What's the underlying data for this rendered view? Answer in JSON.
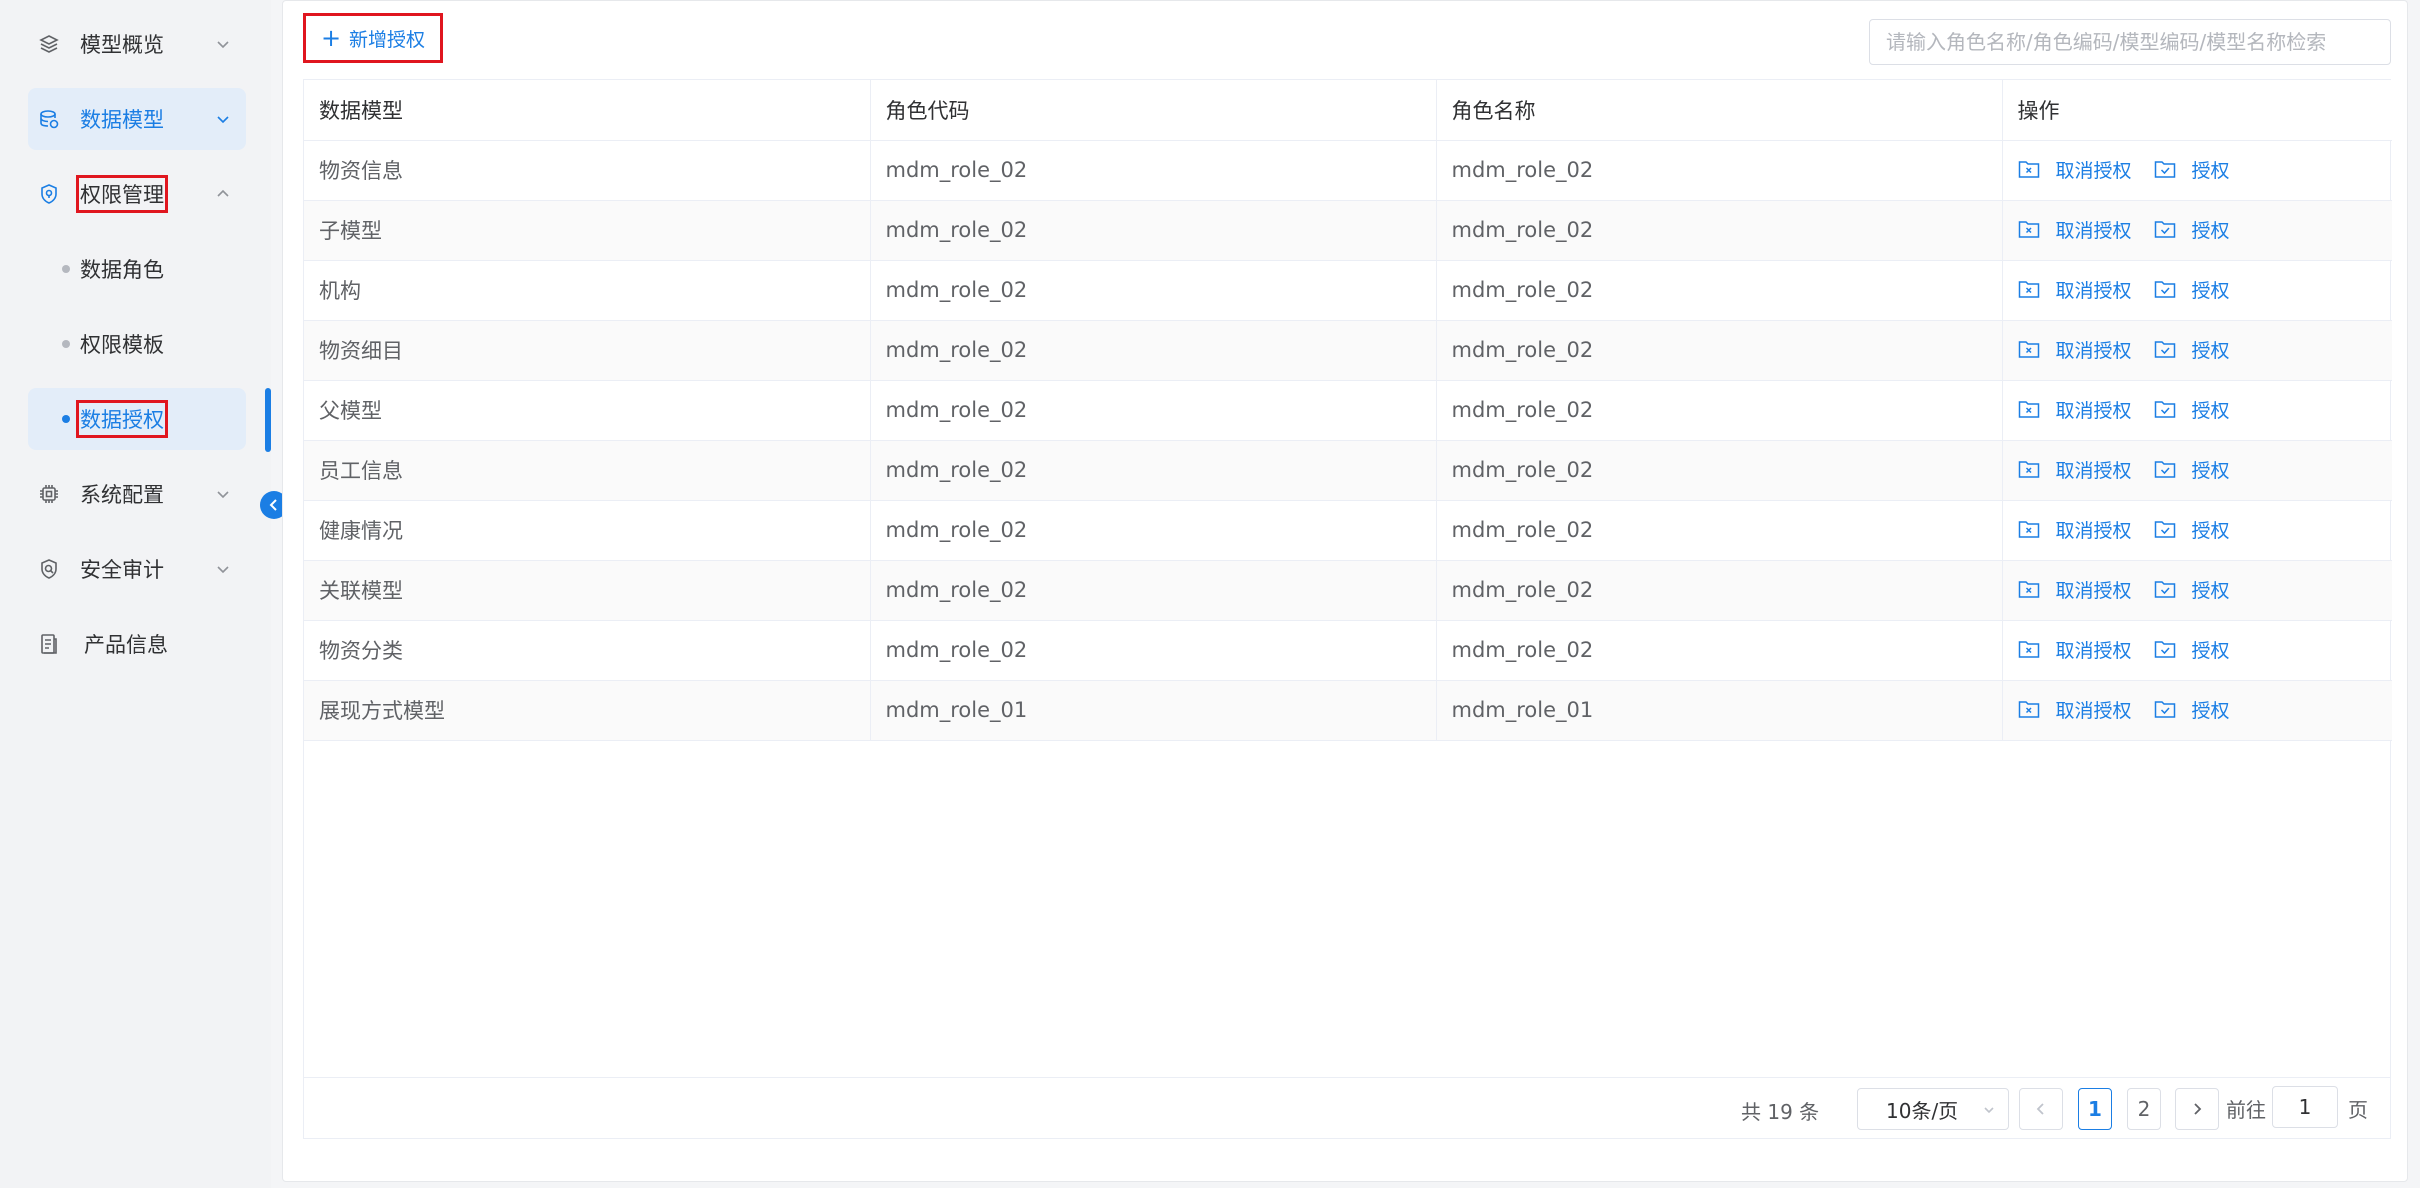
{
  "sidebar": {
    "items": [
      {
        "label": "模型概览",
        "icon": "layers-icon"
      },
      {
        "label": "数据模型",
        "icon": "database-icon"
      },
      {
        "label": "权限管理",
        "icon": "shield-icon"
      },
      {
        "label": "系统配置",
        "icon": "chip-icon"
      },
      {
        "label": "安全审计",
        "icon": "audit-icon"
      },
      {
        "label": "产品信息",
        "icon": "document-icon"
      }
    ],
    "subitems": [
      {
        "label": "数据角色"
      },
      {
        "label": "权限模板"
      },
      {
        "label": "数据授权"
      }
    ]
  },
  "toolbar": {
    "add_label": "新增授权",
    "search_placeholder": "请输入角色名称/角色编码/模型编码/模型名称检索"
  },
  "table": {
    "headers": [
      "数据模型",
      "角色代码",
      "角色名称",
      "操作"
    ],
    "rows": [
      {
        "model": "物资信息",
        "code": "mdm_role_02",
        "name": "mdm_role_02"
      },
      {
        "model": "子模型",
        "code": "mdm_role_02",
        "name": "mdm_role_02"
      },
      {
        "model": "机构",
        "code": "mdm_role_02",
        "name": "mdm_role_02"
      },
      {
        "model": "物资细目",
        "code": "mdm_role_02",
        "name": "mdm_role_02"
      },
      {
        "model": "父模型",
        "code": "mdm_role_02",
        "name": "mdm_role_02"
      },
      {
        "model": "员工信息",
        "code": "mdm_role_02",
        "name": "mdm_role_02"
      },
      {
        "model": "健康情况",
        "code": "mdm_role_02",
        "name": "mdm_role_02"
      },
      {
        "model": "关联模型",
        "code": "mdm_role_02",
        "name": "mdm_role_02"
      },
      {
        "model": "物资分类",
        "code": "mdm_role_02",
        "name": "mdm_role_02"
      },
      {
        "model": "展现方式模型",
        "code": "mdm_role_01",
        "name": "mdm_role_01"
      }
    ],
    "actions": {
      "revoke": "取消授权",
      "grant": "授权"
    }
  },
  "pagination": {
    "total": "共 19 条",
    "page_size": "10条/页",
    "pages": [
      "1",
      "2"
    ],
    "current_page": "1",
    "goto_label": "前往",
    "goto_value": "1",
    "unit": "页"
  },
  "colors": {
    "accent": "#1b7ee4",
    "highlight": "#e0161f"
  }
}
